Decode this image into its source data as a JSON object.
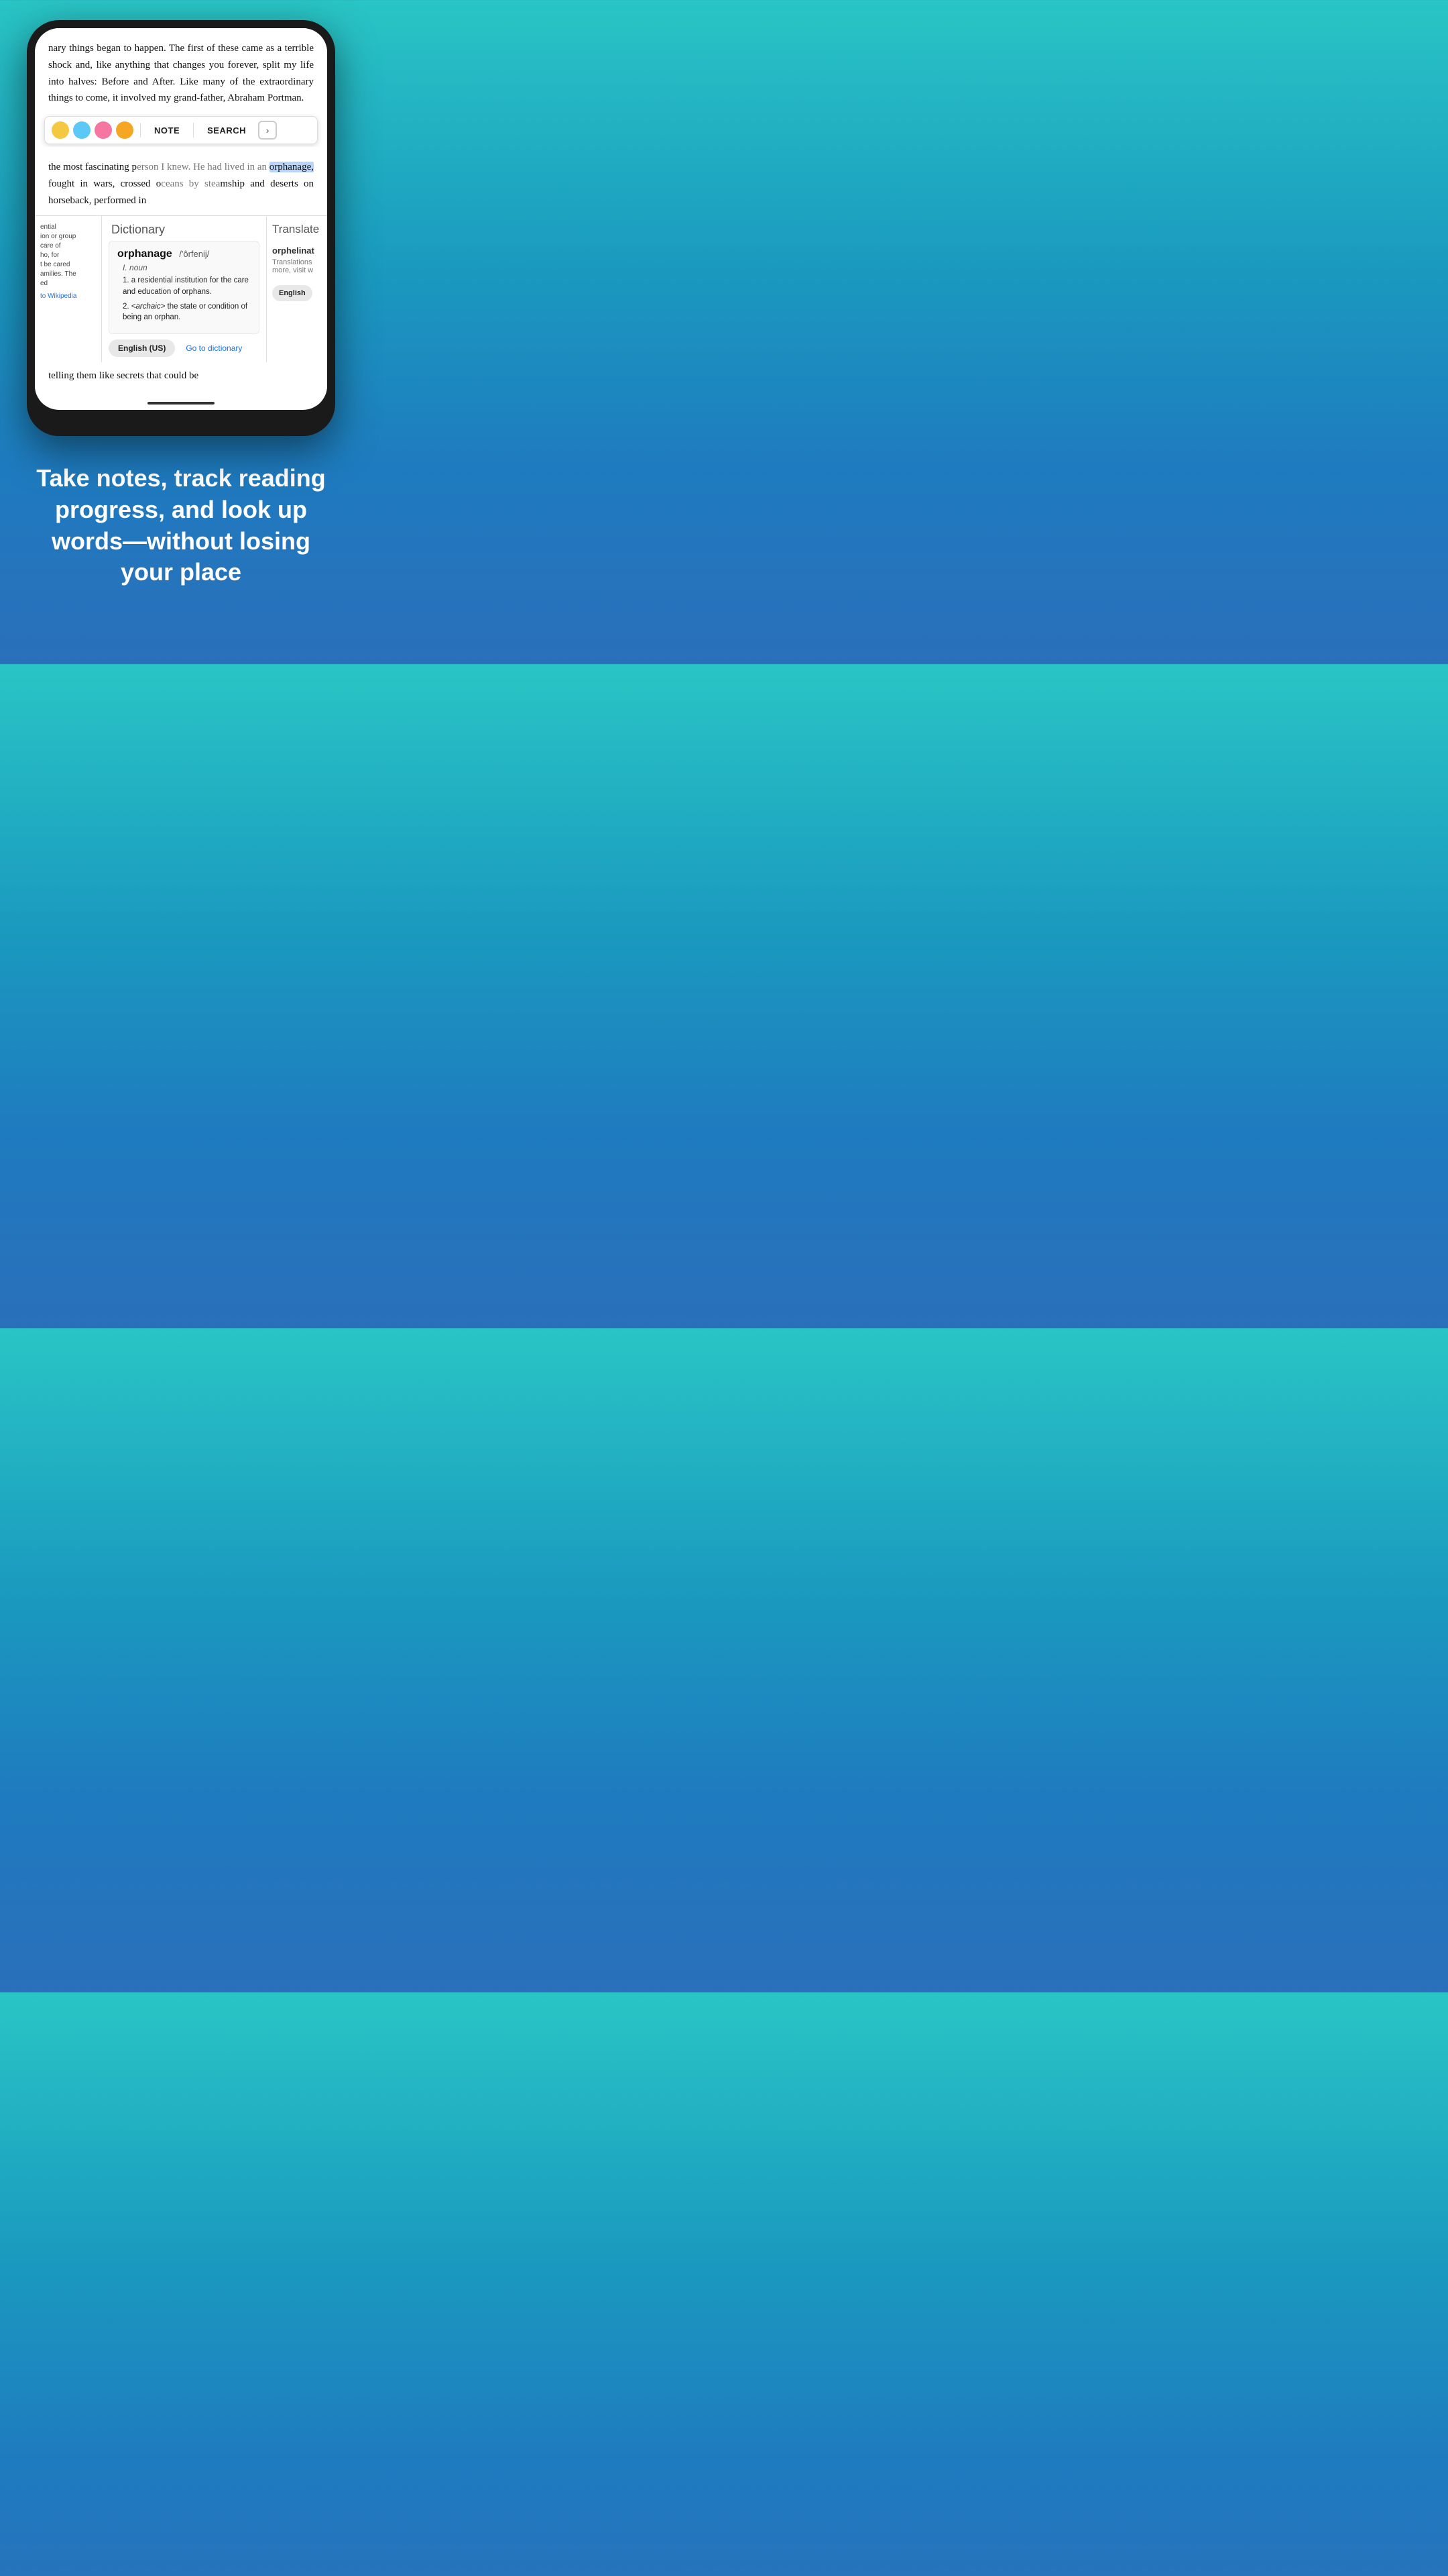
{
  "background": {
    "gradient_start": "#29c5c5",
    "gradient_end": "#2a6fba"
  },
  "phone": {
    "book_text_top": "nary things began to happen. The first of these came as a terrible shock and, like anything that changes you forever, split my life into halves: Before and After. Like many of the extraordinary things to come, it involved my grand-father, Abraham Portman.",
    "book_text_mid_before": "the most fascinating",
    "book_text_mid_word_pre": "person I knew. He had lived in an",
    "highlighted_word": "orphanage,",
    "book_text_mid_after": "fought in wars, crossed oceans by steamship and deserts on horseback, performed in",
    "book_text_bottom": "telling them like secrets that could be",
    "toolbar": {
      "note_label": "NOTE",
      "search_label": "SEARCH",
      "arrow_label": "›",
      "colors": [
        "#f5c842",
        "#5bc8f5",
        "#f576a0",
        "#f5a623"
      ]
    },
    "wikipedia_panel": {
      "text_lines": [
        "ential",
        "ion or group",
        "care of",
        "ho, for",
        "t be cared",
        "amilies. The",
        "ed"
      ],
      "link": "to Wikipedia"
    },
    "dictionary_panel": {
      "header": "Dictionary",
      "word": "orphanage",
      "pronunciation": "/'ôrfenij/",
      "part_of_speech": "noun",
      "pos_numeral": "I.",
      "definitions": [
        {
          "number": "1.",
          "text": "a residential institution for the care and education of orphans."
        },
        {
          "number": "2.",
          "text": "<archaic> the state or condition of being an orphan."
        }
      ],
      "btn_language": "English (US)",
      "btn_goto": "Go to dictionary"
    },
    "translate_panel": {
      "header": "Translate",
      "word": "orphelinat",
      "description": "Translations",
      "more_text": "more, visit w",
      "btn_language": "English"
    }
  },
  "tagline": {
    "text": "Take notes, track reading progress, and look up words—without losing your place"
  }
}
